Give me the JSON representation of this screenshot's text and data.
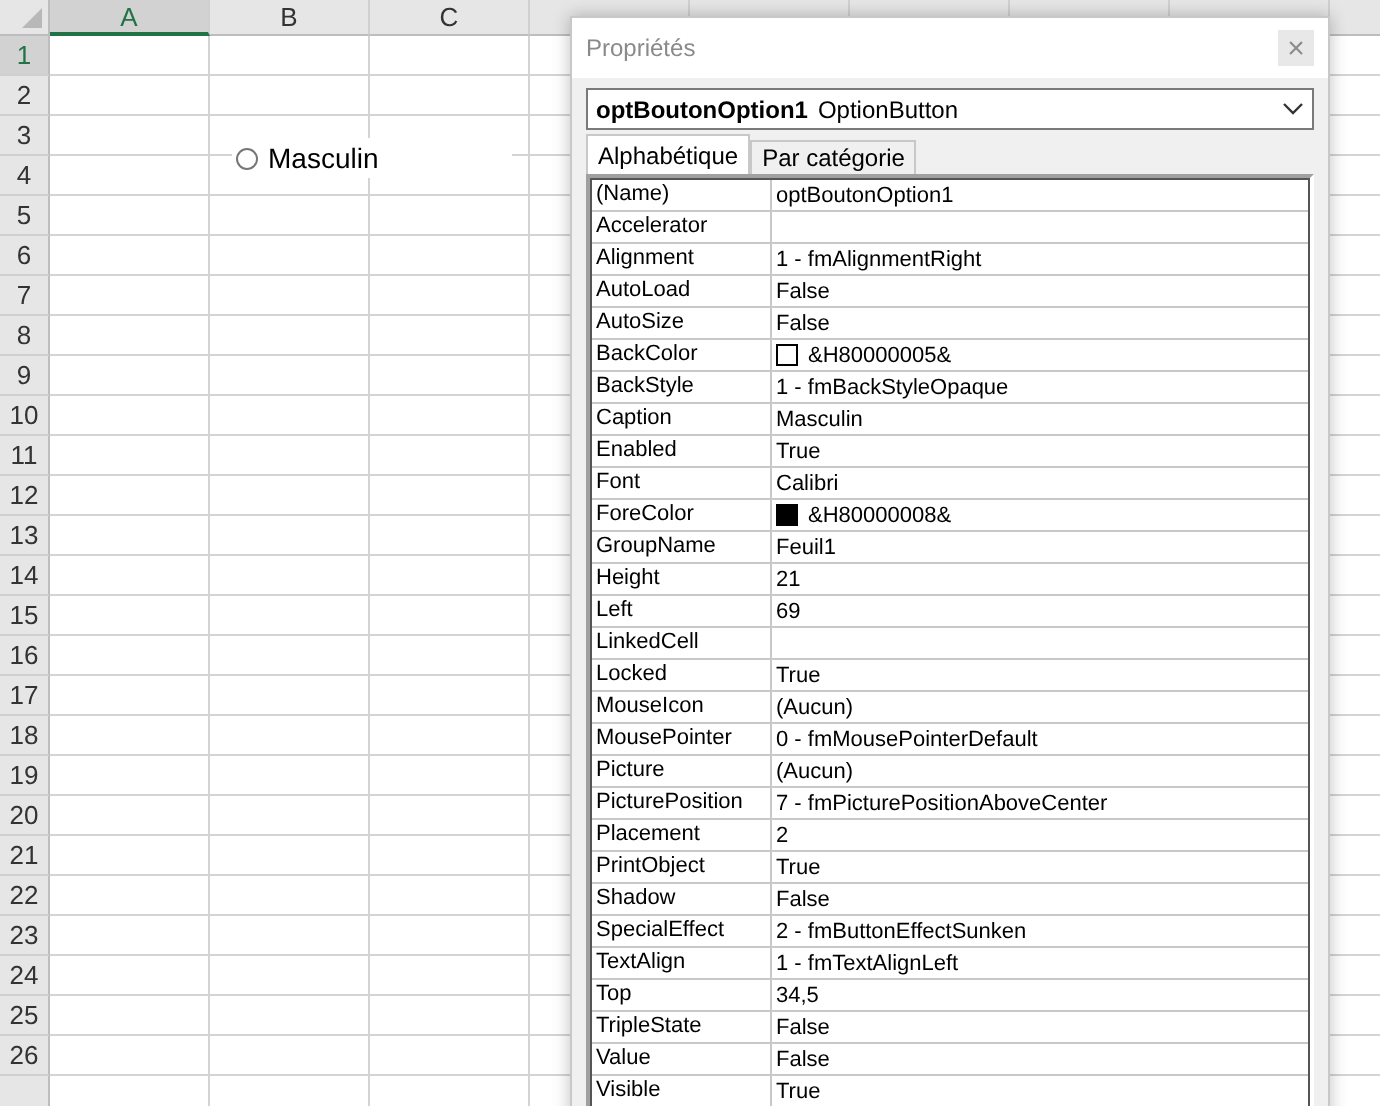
{
  "sheet": {
    "columns": [
      {
        "label": "A",
        "selected": true
      },
      {
        "label": "B",
        "selected": false
      },
      {
        "label": "C",
        "selected": false
      }
    ],
    "rows": [
      {
        "label": "1",
        "selected": true
      },
      {
        "label": "2",
        "selected": false
      },
      {
        "label": "3",
        "selected": false
      },
      {
        "label": "4",
        "selected": false
      },
      {
        "label": "5",
        "selected": false
      },
      {
        "label": "6",
        "selected": false
      },
      {
        "label": "7",
        "selected": false
      },
      {
        "label": "8",
        "selected": false
      },
      {
        "label": "9",
        "selected": false
      },
      {
        "label": "10",
        "selected": false
      },
      {
        "label": "11",
        "selected": false
      },
      {
        "label": "12",
        "selected": false
      },
      {
        "label": "13",
        "selected": false
      },
      {
        "label": "14",
        "selected": false
      },
      {
        "label": "15",
        "selected": false
      },
      {
        "label": "16",
        "selected": false
      },
      {
        "label": "17",
        "selected": false
      },
      {
        "label": "18",
        "selected": false
      },
      {
        "label": "19",
        "selected": false
      },
      {
        "label": "20",
        "selected": false
      },
      {
        "label": "21",
        "selected": false
      },
      {
        "label": "22",
        "selected": false
      },
      {
        "label": "23",
        "selected": false
      },
      {
        "label": "24",
        "selected": false
      },
      {
        "label": "25",
        "selected": false
      },
      {
        "label": "26",
        "selected": false
      }
    ],
    "option_button": {
      "label": "Masculin",
      "checked": false
    }
  },
  "properties_window": {
    "title": "Propriétés",
    "close": "×",
    "object_selector": {
      "name": "optBoutonOption1",
      "type": "OptionButton"
    },
    "tabs": [
      {
        "label": "Alphabétique",
        "selected": true
      },
      {
        "label": "Par catégorie",
        "selected": false
      }
    ],
    "properties": [
      {
        "name": "(Name)",
        "value": "optBoutonOption1"
      },
      {
        "name": "Accelerator"
      },
      {
        "name": "Alignment",
        "value": "1 - fmAlignmentRight"
      },
      {
        "name": "AutoLoad",
        "value": "False"
      },
      {
        "name": "AutoSize",
        "value": "False"
      },
      {
        "name": "BackColor",
        "value": "&H80000005&",
        "color": "#ffffff"
      },
      {
        "name": "BackStyle",
        "value": "1 - fmBackStyleOpaque"
      },
      {
        "name": "Caption",
        "value": "Masculin"
      },
      {
        "name": "Enabled",
        "value": "True"
      },
      {
        "name": "Font",
        "value": "Calibri"
      },
      {
        "name": "ForeColor",
        "value": "&H80000008&",
        "color": "#000000"
      },
      {
        "name": "GroupName",
        "value": "Feuil1"
      },
      {
        "name": "Height",
        "value": "21"
      },
      {
        "name": "Left",
        "value": "69"
      },
      {
        "name": "LinkedCell"
      },
      {
        "name": "Locked",
        "value": "True"
      },
      {
        "name": "MouseIcon",
        "value": "(Aucun)"
      },
      {
        "name": "MousePointer",
        "value": "0 - fmMousePointerDefault"
      },
      {
        "name": "Picture",
        "value": "(Aucun)"
      },
      {
        "name": "PicturePosition",
        "value": "7 - fmPicturePositionAboveCenter"
      },
      {
        "name": "Placement",
        "value": "2"
      },
      {
        "name": "PrintObject",
        "value": "True"
      },
      {
        "name": "Shadow",
        "value": "False"
      },
      {
        "name": "SpecialEffect",
        "value": "2 - fmButtonEffectSunken"
      },
      {
        "name": "TextAlign",
        "value": "1 - fmTextAlignLeft"
      },
      {
        "name": "Top",
        "value": "34,5"
      },
      {
        "name": "TripleState",
        "value": "False"
      },
      {
        "name": "Value",
        "value": "False"
      },
      {
        "name": "Visible",
        "value": "True"
      }
    ]
  }
}
